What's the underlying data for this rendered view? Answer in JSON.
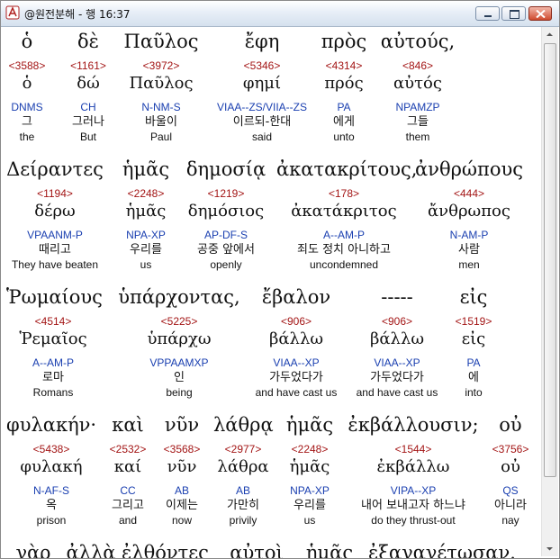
{
  "window": {
    "title": "@원전분해 - 행 16:37"
  },
  "rows": [
    {
      "words": [
        {
          "greek": "ὁ",
          "strong": "<3588>",
          "lemma": "ὁ",
          "parse": "DNMS",
          "korean": "그",
          "english": "the"
        },
        {
          "greek": "δὲ",
          "strong": "<1161>",
          "lemma": "δώ",
          "parse": "CH",
          "korean": "그러나",
          "english": "But"
        },
        {
          "greek": "Παῦλος",
          "strong": "<3972>",
          "lemma": "Παῦλος",
          "parse": "N-NM-S",
          "korean": "바울이",
          "english": "Paul"
        },
        {
          "greek": "ἔφη",
          "strong": "<5346>",
          "lemma": "φημί",
          "parse": "VIAA--ZS/VIIA--ZS",
          "korean": "이르되-한대",
          "english": "said"
        },
        {
          "greek": "πρὸς",
          "strong": "<4314>",
          "lemma": "πρός",
          "parse": "PA",
          "korean": "에게",
          "english": "unto"
        },
        {
          "greek": "αὐτούς,",
          "strong": "<846>",
          "lemma": "αὐτός",
          "parse": "NPAMZP",
          "korean": "그들",
          "english": "them"
        }
      ]
    },
    {
      "words": [
        {
          "greek": "Δείραντες",
          "strong": "<1194>",
          "lemma": "δέρω",
          "parse": "VPAANM-P",
          "korean": "때리고",
          "english": "They have beaten"
        },
        {
          "greek": "ἡμᾶς",
          "strong": "<2248>",
          "lemma": "ἡμᾶς",
          "parse": "NPA-XP",
          "korean": "우리를",
          "english": "us"
        },
        {
          "greek": "δημοσίᾳ",
          "strong": "<1219>",
          "lemma": "δημόσιος",
          "parse": "AP-DF-S",
          "korean": "공중 앞에서",
          "english": "openly"
        },
        {
          "greek": "ἀκατακρίτους,",
          "strong": "<178>",
          "lemma": "ἀκατάκριτος",
          "parse": "A--AM-P",
          "korean": "죄도 정치 아니하고",
          "english": "uncondemned"
        },
        {
          "greek": "ἀνθρώπους",
          "strong": "<444>",
          "lemma": "ἄνθρωπος",
          "parse": "N-AM-P",
          "korean": "사람",
          "english": "men"
        }
      ]
    },
    {
      "words": [
        {
          "greek": "Ῥωμαίους",
          "strong": "<4514>",
          "lemma": "Ῥεμαῖος",
          "parse": "A--AM-P",
          "korean": "로마",
          "english": "Romans"
        },
        {
          "greek": "ὑπάρχοντας,",
          "strong": "<5225>",
          "lemma": "ὑπάρχω",
          "parse": "VPPAAMXP",
          "korean": "인",
          "english": "being"
        },
        {
          "greek": "ἔβαλον",
          "strong": "<906>",
          "lemma": "βάλλω",
          "parse": "VIAA--XP",
          "korean": "가두었다가",
          "english": "and have cast us"
        },
        {
          "greek": "-----",
          "strong": "<906>",
          "lemma": "βάλλω",
          "parse": "VIAA--XP",
          "korean": "가두었다가",
          "english": "and have cast us"
        },
        {
          "greek": "εἰς",
          "strong": "<1519>",
          "lemma": "εἰς",
          "parse": "PA",
          "korean": "에",
          "english": "into"
        }
      ]
    },
    {
      "words": [
        {
          "greek": "φυλακήν·",
          "strong": "<5438>",
          "lemma": "φυλακή",
          "parse": "N-AF-S",
          "korean": "옥",
          "english": "prison"
        },
        {
          "greek": "καὶ",
          "strong": "<2532>",
          "lemma": "καί",
          "parse": "CC",
          "korean": "그리고",
          "english": "and"
        },
        {
          "greek": "νῦν",
          "strong": "<3568>",
          "lemma": "νῦν",
          "parse": "AB",
          "korean": "이제는",
          "english": "now"
        },
        {
          "greek": "λάθρᾳ",
          "strong": "<2977>",
          "lemma": "λάθρα",
          "parse": "AB",
          "korean": "가만히",
          "english": "privily"
        },
        {
          "greek": "ἡμᾶς",
          "strong": "<2248>",
          "lemma": "ἡμᾶς",
          "parse": "NPA-XP",
          "korean": "우리를",
          "english": "us"
        },
        {
          "greek": "ἐκβάλλουσιν;",
          "strong": "<1544>",
          "lemma": "ἐκβάλλω",
          "parse": "VIPA--XP",
          "korean": "내어 보내고자 하느냐",
          "english": "do they thrust-out"
        },
        {
          "greek": "οὐ",
          "strong": "<3756>",
          "lemma": "οὐ",
          "parse": "QS",
          "korean": "아니라",
          "english": "nay"
        }
      ]
    },
    {
      "words": [
        {
          "greek": "γὰρ",
          "strong": "",
          "lemma": "",
          "parse": "",
          "korean": "",
          "english": ""
        },
        {
          "greek": "ἀλλὰ",
          "strong": "",
          "lemma": "",
          "parse": "",
          "korean": "",
          "english": ""
        },
        {
          "greek": "ἐλθόντες",
          "strong": "",
          "lemma": "",
          "parse": "",
          "korean": "",
          "english": ""
        },
        {
          "greek": "αὐτοὶ",
          "strong": "",
          "lemma": "",
          "parse": "",
          "korean": "",
          "english": ""
        },
        {
          "greek": "ἡμᾶς",
          "strong": "",
          "lemma": "",
          "parse": "",
          "korean": "",
          "english": ""
        },
        {
          "greek": "ἐξαγαγέτωσαν.",
          "strong": "",
          "lemma": "",
          "parse": "",
          "korean": "",
          "english": ""
        }
      ]
    }
  ]
}
